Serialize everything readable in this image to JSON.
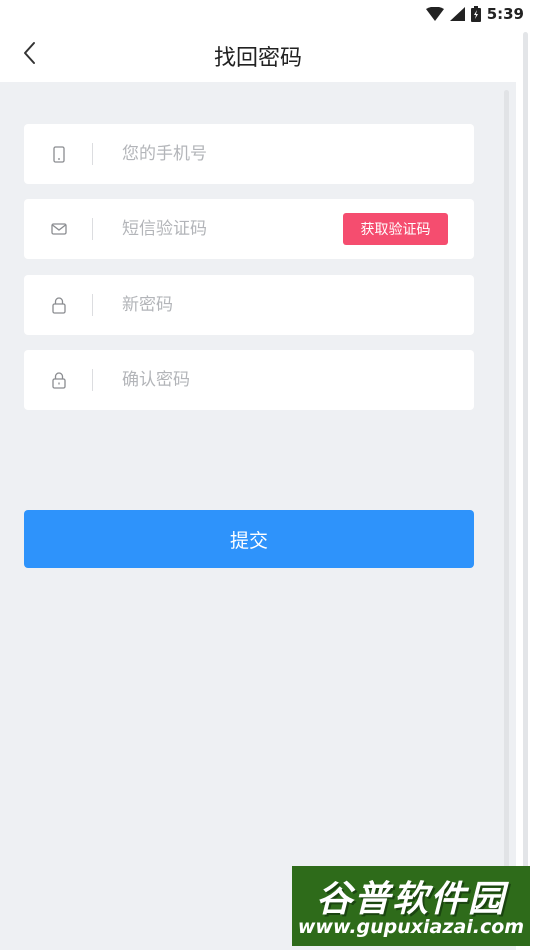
{
  "status_bar": {
    "time": "5:39",
    "icons": [
      "wifi-icon",
      "cellular-signal-icon",
      "battery-icon"
    ]
  },
  "header": {
    "title": "找回密码",
    "back_icon": "chevron-left-icon"
  },
  "form": {
    "phone": {
      "placeholder": "您的手机号",
      "icon": "phone-icon"
    },
    "sms_code": {
      "placeholder": "短信验证码",
      "icon": "mail-icon",
      "button_label": "获取验证码"
    },
    "new_password": {
      "placeholder": "新密码",
      "icon": "lock-icon"
    },
    "confirm_password": {
      "placeholder": "确认密码",
      "icon": "lock-icon"
    },
    "submit_label": "提交"
  },
  "watermark": {
    "title": "谷普软件园",
    "url": "www.gupuxiazai.com"
  },
  "colors": {
    "background": "#eef0f3",
    "accent_blue": "#2e93fb",
    "accent_pink": "#f54d6f",
    "placeholder": "#b3b5b9"
  }
}
